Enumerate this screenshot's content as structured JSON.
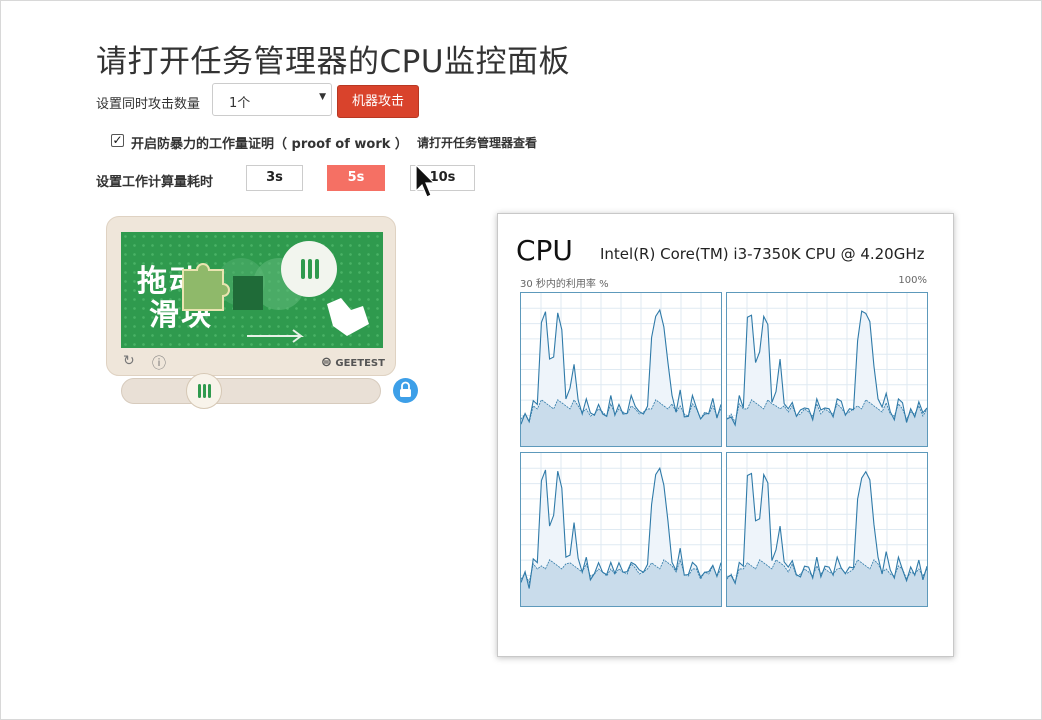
{
  "page_title": "请打开任务管理器的CPU监控面板",
  "attack": {
    "label": "设置同时攻击数量",
    "select_value": "1个",
    "button_label": "机器攻击"
  },
  "proof_of_work": {
    "checked": true,
    "label": "开启防暴力的工作量证明（ proof of work ）",
    "hint": "请打开任务管理器查看"
  },
  "work_time": {
    "label": "设置工作计算量耗时",
    "options": [
      "3s",
      "5s",
      "10s"
    ],
    "active": "5s"
  },
  "captcha": {
    "image_text_line1": "拖动",
    "image_text_line2": "滑块",
    "brand": "GEETEST",
    "refresh_icon": "refresh-icon",
    "info_icon": "info-icon",
    "accent_color": "#2f9a4e"
  },
  "cpu_monitor": {
    "title": "CPU",
    "model": "Intel(R) Core(TM) i3-7350K CPU @ 4.20GHz",
    "subtitle": "30 秒内的利用率 %",
    "max_label": "100%"
  },
  "colors": {
    "attack_button": "#d9432c",
    "active_time_button": "#f57064",
    "lock": "#3d9fe8",
    "graph_line": "#2f7aa8"
  }
}
